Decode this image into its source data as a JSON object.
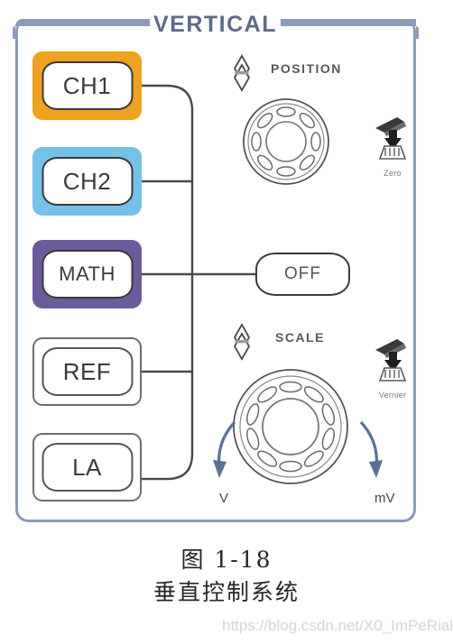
{
  "panel": {
    "title": "VERTICAL",
    "frame_color": "#8b9bb8"
  },
  "channels": [
    {
      "id": "ch1",
      "label": "CH1",
      "bg_color": "#eda31f",
      "filled": true
    },
    {
      "id": "ch2",
      "label": "CH2",
      "bg_color": "#74c2e8",
      "filled": true
    },
    {
      "id": "math",
      "label": "MATH",
      "bg_color": "#6b5b9a",
      "filled": true
    },
    {
      "id": "ref",
      "label": "REF",
      "bg_color": "#ffffff",
      "filled": false
    },
    {
      "id": "la",
      "label": "LA",
      "bg_color": "#ffffff",
      "filled": false
    }
  ],
  "off_button": {
    "label": "OFF"
  },
  "controls": {
    "position": {
      "label": "POSITION",
      "updown_icon": "updown-arrow-icon",
      "knob_icon": "rotary-knob-icon",
      "knob_notches": 8,
      "press_icon": "press-knob-icon",
      "press_label": "Zero"
    },
    "scale": {
      "label": "SCALE",
      "updown_icon": "updown-arrow-icon",
      "knob_icon": "rotary-knob-icon",
      "knob_notches": 10,
      "press_icon": "press-knob-icon",
      "press_label": "Vernier",
      "arrow_left_label": "V",
      "arrow_right_label": "mV",
      "arrow_color": "#5a7193"
    }
  },
  "caption": {
    "figure": "图 1-18",
    "title": "垂直控制系统"
  },
  "watermark": {
    "text": "https://blog.csdn.net/X0_ImPeRial"
  }
}
